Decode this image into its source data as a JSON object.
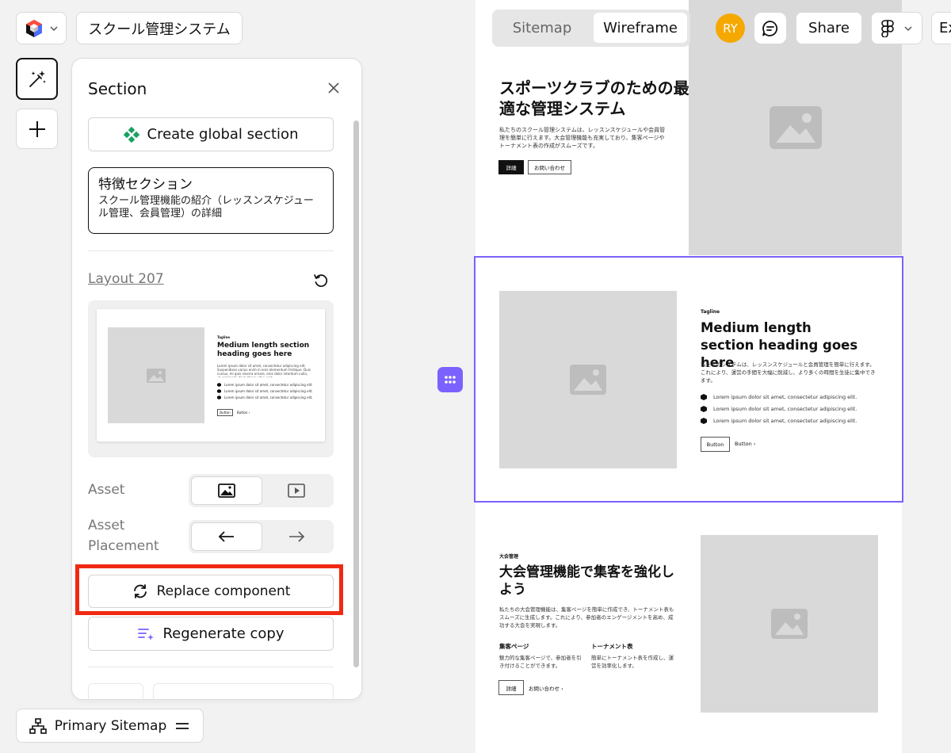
{
  "header": {
    "project_name": "スクール管理システム",
    "tabs": [
      {
        "label": "Sitemap"
      },
      {
        "label": "Wireframe"
      }
    ],
    "active_tab": "Wireframe",
    "avatar_initials": "RY",
    "share_label": "Share",
    "export_label_partial": "Ex"
  },
  "panel": {
    "title": "Section",
    "create_global_label": "Create global section",
    "section_card": {
      "title": "特徴セクション",
      "description": "スクール管理機能の紹介（レッスンスケジュール管理、会員管理）の詳細"
    },
    "layout_name": "Layout 207",
    "preview": {
      "tagline": "Tagline",
      "heading": "Medium length section heading goes here",
      "body": "Lorem ipsum dolor sit amet, consectetur adipiscing elit. Suspendisse varius enim in eros elementum tristique. Duis cursus, mi quis viverra ornare, eros dolor interdum nulla, ut commodo diam libero vitae erat.",
      "bullets": [
        "Lorem ipsum dolor sit amet, consectetur adipiscing elit.",
        "Lorem ipsum dolor sit amet, consectetur adipiscing elit.",
        "Lorem ipsum dolor sit amet, consectetur adipiscing elit."
      ],
      "button_label": "Button",
      "link_label": "Button"
    },
    "asset_label": "Asset",
    "asset_placement_label": "Asset Placement",
    "replace_label": "Replace component",
    "regenerate_label": "Regenerate copy"
  },
  "sitemap_button_label": "Primary Sitemap",
  "canvas": {
    "hero": {
      "heading": "スポーツクラブのための最適な管理システム",
      "body": "私たちのスクール管理システムは、レッスンスケジュールや会員管理を簡単に行えます。大会管理機能も充実しており、集客ページやトーナメント表の作成がスムーズです。",
      "primary_button": "詳細",
      "secondary_button": "お問い合わせ"
    },
    "feature": {
      "tagline": "Tagline",
      "heading": "Medium length section heading goes here",
      "body": "私たちのシステムは、レッスンスケジュールと会員管理を簡単に行えます。これにより、運営の手間を大幅に削減し、より多くの時間を生徒に集中できます。",
      "bullets": [
        "Lorem ipsum dolor sit amet, consectetur adipiscing elit.",
        "Lorem ipsum dolor sit amet, consectetur adipiscing elit.",
        "Lorem ipsum dolor sit amet, consectetur adipiscing elit."
      ],
      "button_label": "Button",
      "link_label": "Button"
    },
    "tournament": {
      "tagline": "大会管理",
      "heading": "大会管理機能で集客を強化しよう",
      "body": "私たちの大会管理機能は、集客ページを簡単に作成でき、トーナメント表もスムーズに生成します。これにより、参加者のエンゲージメントを高め、成功する大会を実現します。",
      "col1_title": "集客ページ",
      "col1_body": "魅力的な集客ページで、参加者を引き付けることができます。",
      "col2_title": "トーナメント表",
      "col2_body": "簡単にトーナメント表を作成し、運営を効率化します。",
      "primary_button": "詳細",
      "secondary_button": "お問い合わせ"
    }
  },
  "colors": {
    "accent": "#7b61ff",
    "highlight": "#ee2a12",
    "avatar": "#f5a800",
    "placeholder": "#d9d9d9"
  }
}
